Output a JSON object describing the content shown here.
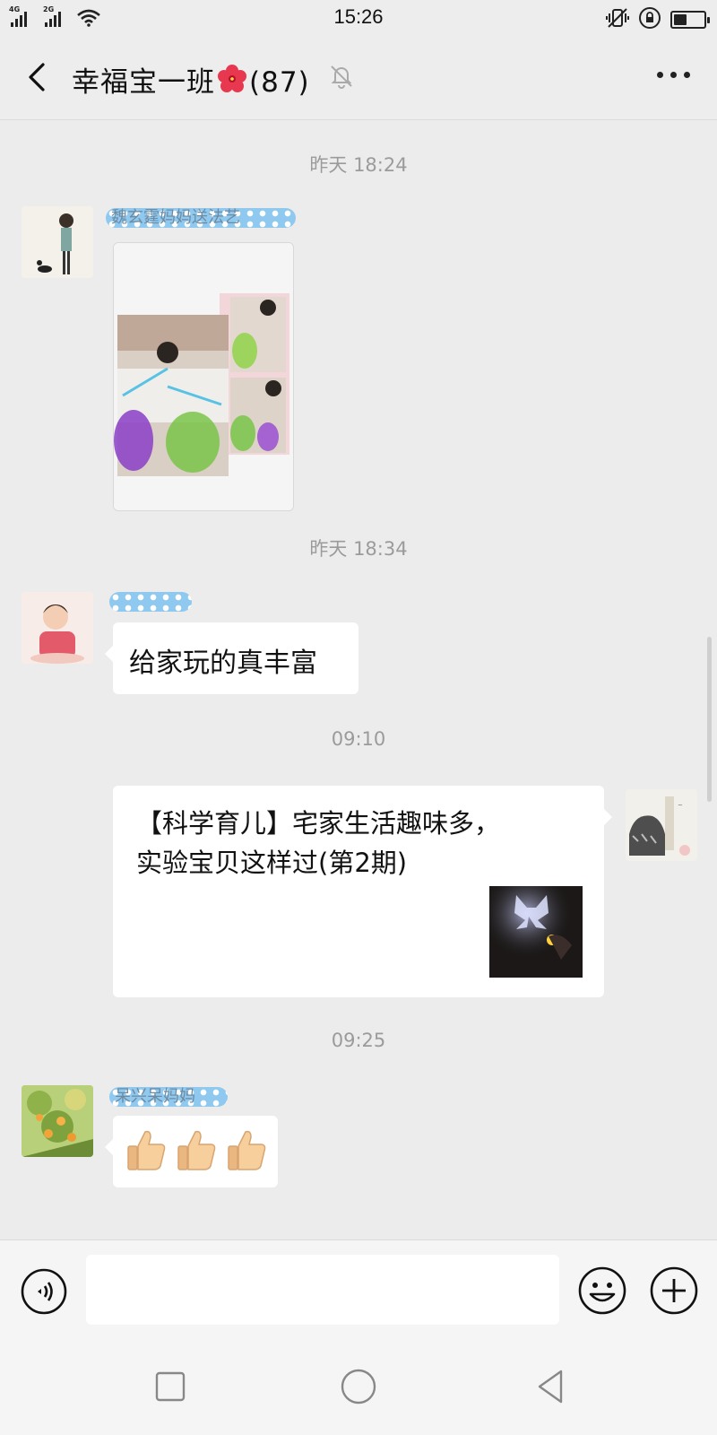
{
  "status_bar": {
    "network_1": "4G",
    "network_2": "2G",
    "time": "15:26"
  },
  "header": {
    "title": "幸福宝一班",
    "member_count": "(87)",
    "back_icon": "chevron-left-icon",
    "mute_icon": "bell-off-icon",
    "more_icon": "more-dots-icon"
  },
  "messages": [
    {
      "type": "timestamp",
      "text": "昨天 18:24"
    },
    {
      "type": "image",
      "side": "left",
      "sender": "魏玄霆妈妈送法艺"
    },
    {
      "type": "timestamp",
      "text": "昨天 18:34"
    },
    {
      "type": "text",
      "side": "left",
      "text": "给家玩的真丰富"
    },
    {
      "type": "timestamp",
      "text": "09:10"
    },
    {
      "type": "article",
      "side": "right",
      "title_line1": "【科学育儿】宅家生活趣味多，",
      "title_line2": "实验宝贝这样过(第2期)"
    },
    {
      "type": "timestamp",
      "text": "09:25"
    },
    {
      "type": "emoji",
      "side": "left",
      "sender": "呆兴呆妈妈",
      "emojis": "👍👍👍"
    }
  ],
  "input_bar": {
    "placeholder": "",
    "voice_icon": "voice-icon",
    "emoji_icon": "emoji-icon",
    "plus_icon": "plus-icon"
  },
  "nav_bar": {
    "recent_icon": "square-icon",
    "home_icon": "circle-icon",
    "back_icon": "triangle-back-icon"
  },
  "colors": {
    "background": "#ececec",
    "bubble": "#ffffff",
    "timestamp": "#9b9b9b",
    "nickname_highlight": "#8fc9ef"
  }
}
